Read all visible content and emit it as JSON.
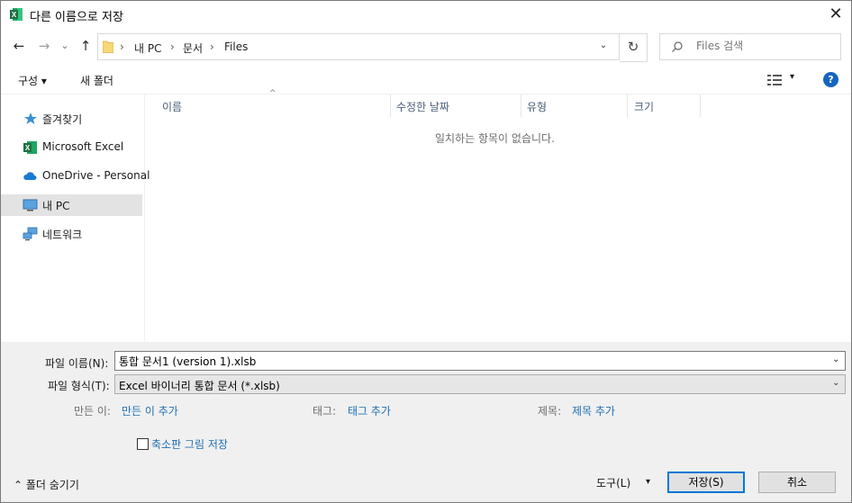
{
  "window": {
    "title": "다른 이름으로 저장",
    "close_glyph": "✕"
  },
  "nav": {
    "back_glyph": "←",
    "forward_glyph": "→",
    "recent_glyph": "⌄",
    "up_glyph": "↑",
    "breadcrumb": [
      "내 PC",
      "문서",
      "Files"
    ],
    "separator": "›",
    "dropdown_glyph": "⌄",
    "refresh_glyph": "↻",
    "search_placeholder": "Files 검색"
  },
  "toolbar": {
    "organize": "구성 ▾",
    "new_folder": "새 폴더",
    "help": "?",
    "view_dropdown": "▾"
  },
  "sidebar": {
    "items": [
      {
        "label": "즐겨찾기",
        "icon": "star-icon"
      },
      {
        "label": "Microsoft Excel",
        "icon": "excel-icon"
      },
      {
        "label": "OneDrive - Personal",
        "icon": "cloud-icon"
      },
      {
        "label": "내 PC",
        "icon": "computer-icon",
        "selected": true
      },
      {
        "label": "네트워크",
        "icon": "network-icon"
      }
    ]
  },
  "filelist": {
    "columns": [
      "이름",
      "수정한 날짜",
      "유형",
      "크기"
    ],
    "sort_glyph": "^",
    "empty_message": "일치하는 항목이 없습니다."
  },
  "form": {
    "filename_label": "파일 이름(N):",
    "filename_value": "통합 문서1 (version 1).xlsb",
    "filetype_label": "파일 형식(T):",
    "filetype_value": "Excel 바이너리 통합 문서 (*.xlsb)",
    "authors_label": "만든 이:",
    "authors_link": "만든 이 추가",
    "tags_label": "태그:",
    "tags_link": "태그 추가",
    "title_label": "제목:",
    "title_link": "제목 추가",
    "thumbnail_label": "축소판 그림 저장",
    "thumbnail_checked": false,
    "chevron_glyph": "⌄"
  },
  "footer": {
    "hide_folders": "⌃ 폴더 숨기기",
    "tools": "도구(L)",
    "tools_dropdown": "▾",
    "save": "저장(S)",
    "cancel": "취소"
  },
  "colors": {
    "accent": "#0078d7",
    "link": "#1f6fb2",
    "excel_green": "#1d6f42",
    "selection": "#e3e3e3"
  }
}
